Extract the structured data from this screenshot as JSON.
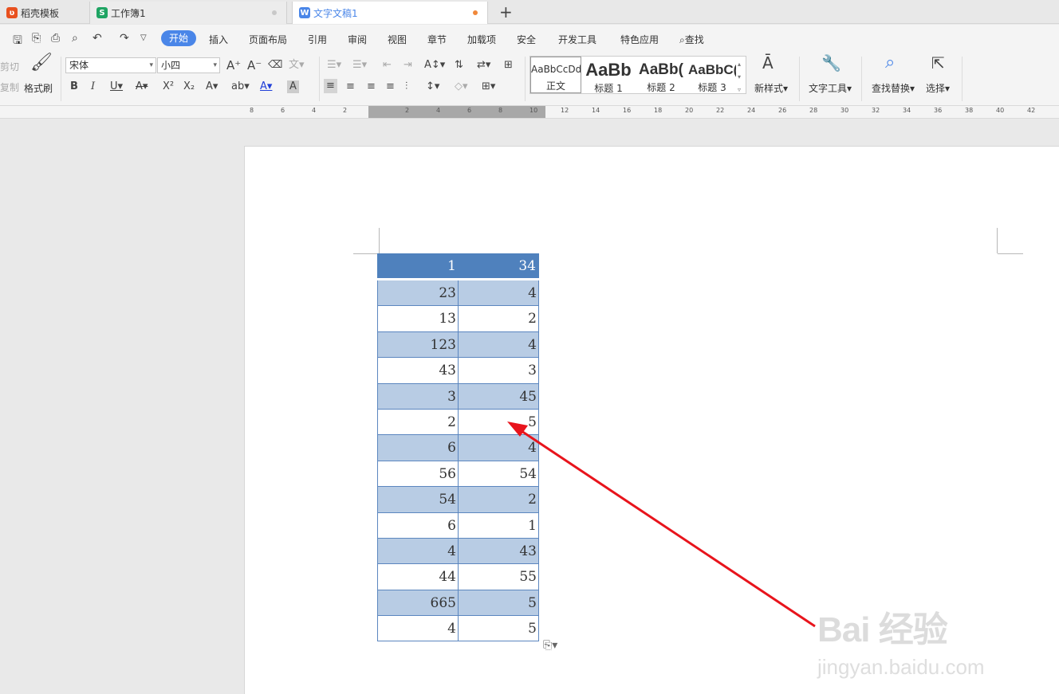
{
  "tabs": [
    {
      "label": "稻壳模板",
      "icon": "docer-icon",
      "color": "#e8501e"
    },
    {
      "label": "工作簿1",
      "icon": "spreadsheet-icon",
      "color": "#1fa463",
      "status_dot": "#c8c8c8"
    },
    {
      "label": "文字文稿1",
      "icon": "writer-icon",
      "color": "#4a86e8",
      "status_dot": "#f0883a"
    }
  ],
  "new_tab": "+",
  "menu": {
    "active": "开始",
    "items": [
      "插入",
      "页面布局",
      "引用",
      "审阅",
      "视图",
      "章节",
      "加载项",
      "安全",
      "开发工具",
      "特色应用"
    ],
    "search": "查找"
  },
  "ribbon": {
    "cut": "剪切",
    "copy": "复制",
    "format_painter": "格式刷",
    "font_name": "宋体",
    "font_size": "小四",
    "styles": [
      {
        "preview": "AaBbCcDd",
        "label": "正文"
      },
      {
        "preview": "AaBb",
        "label": "标题 1"
      },
      {
        "preview": "AaBb(",
        "label": "标题 2"
      },
      {
        "preview": "AaBbC(",
        "label": "标题 3"
      }
    ],
    "new_style": "新样式",
    "text_tools": "文字工具",
    "find_replace": "查找替换",
    "select": "选择"
  },
  "ruler": {
    "left_ticks": [
      "8",
      "6",
      "4",
      "2"
    ],
    "inner_ticks": [
      "2",
      "4",
      "6",
      "8",
      "10"
    ],
    "right_ticks": [
      "12",
      "14",
      "16",
      "18",
      "20",
      "22",
      "24",
      "26",
      "28",
      "30",
      "32",
      "34",
      "36",
      "38",
      "40",
      "42"
    ]
  },
  "table": {
    "header": [
      "1",
      "34"
    ],
    "rows": [
      [
        "23",
        "4"
      ],
      [
        "13",
        "2"
      ],
      [
        "123",
        "4"
      ],
      [
        "43",
        "3"
      ],
      [
        "3",
        "45"
      ],
      [
        "2",
        "5"
      ],
      [
        "6",
        "4"
      ],
      [
        "56",
        "54"
      ],
      [
        "54",
        "2"
      ],
      [
        "6",
        "1"
      ],
      [
        "4",
        "43"
      ],
      [
        "44",
        "55"
      ],
      [
        "665",
        "5"
      ],
      [
        "4",
        "5"
      ]
    ],
    "header_color": "#4f81bd",
    "band_color": "#b8cce4"
  },
  "annotation": {
    "arrow_color": "#e8141c"
  },
  "watermark": {
    "logo": "Bai 经验",
    "url": "jingyan.baidu.com"
  }
}
